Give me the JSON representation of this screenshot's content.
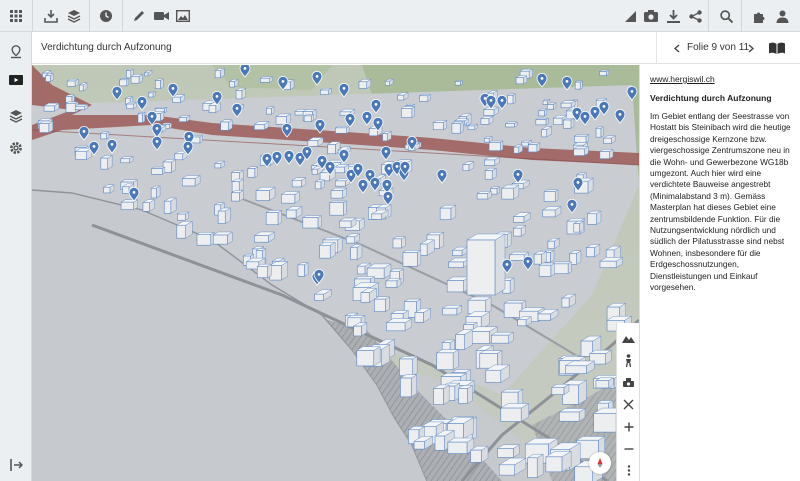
{
  "header": {
    "title": "Verdichtung durch Aufzonung",
    "pager": "Folie 9 von 11"
  },
  "toolbar": {
    "left_icons": [
      "apps-icon",
      "download-upload-icon",
      "layers-icon",
      "history-icon",
      "pencil-icon",
      "video-camera-icon",
      "image-icon"
    ],
    "right_icons": [
      "measure-icon",
      "camera-icon",
      "download-icon",
      "share-icon",
      "search-icon",
      "puzzle-icon",
      "user-icon"
    ]
  },
  "sidebar": {
    "items": [
      "location-icon",
      "presentation-icon",
      "layers-icon",
      "settings-icon"
    ],
    "collapse": "collapse-icon"
  },
  "panel": {
    "link": "www.hergiswil.ch",
    "heading": "Verdichtung durch Aufzonung",
    "body": "Im Gebiet entlang der Seestrasse von Hostatt bis Steinibach wird die heutige dreigeschossige Kernzone bzw. viergeschossige Zentrumszone neu in die Wohn- und Gewerbezone WG18b umgezont. Auch hier wird eine verdichtete Bauweise angestrebt (Minimalabstand 3 m). Gemäss Masterplan hat dieses Gebiet eine zentrumsbildende Funktion. Für die Nutzungsentwicklung nördlich und südlich der Pilatusstrasse sind nebst Wohnen, insbesondere für die Erdgeschossnutzungen, Dienstleistungen und Einkauf vorgesehen."
  },
  "map_controls": [
    "terrain-icon",
    "pedestrian-icon",
    "drone-icon",
    "fullscreen-icon",
    "zoom-in-icon",
    "zoom-out-icon",
    "more-icon"
  ],
  "colors": {
    "accent": "#2f6db5",
    "pin": "#4a78b8",
    "lake": "#c9cccf",
    "railway": "#a85a5a",
    "toolbar": "#eceff1"
  }
}
